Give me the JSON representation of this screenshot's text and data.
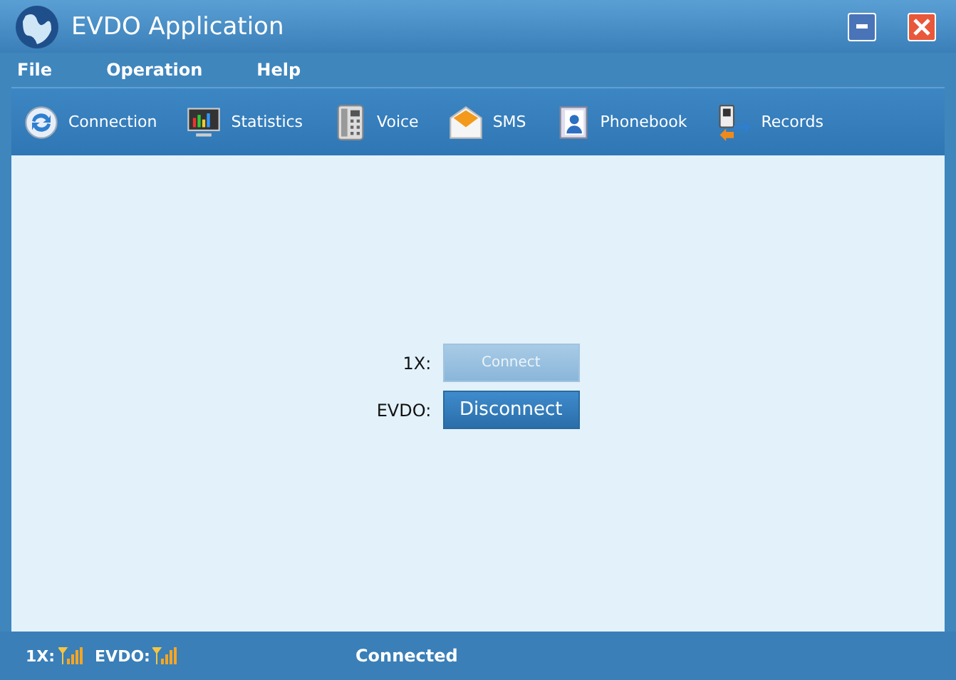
{
  "window": {
    "title": "EVDO Application"
  },
  "menu": [
    "File",
    "Operation",
    "Help"
  ],
  "toolbar": [
    {
      "label": "Connection",
      "kind": "sync"
    },
    {
      "label": "Statistics",
      "kind": "monitor"
    },
    {
      "label": "Voice",
      "kind": "phone"
    },
    {
      "label": "SMS",
      "kind": "mail"
    },
    {
      "label": "Phonebook",
      "kind": "contacts"
    },
    {
      "label": "Records",
      "kind": "transfer"
    }
  ],
  "connections": [
    {
      "label": "1X:",
      "button": "Connect",
      "disabled": true
    },
    {
      "label": "EVDO:",
      "button": "Disconnect",
      "disabled": false
    }
  ],
  "status_bar": {
    "signals": [
      "1X:",
      "EVDO:"
    ],
    "status": "Connected"
  }
}
